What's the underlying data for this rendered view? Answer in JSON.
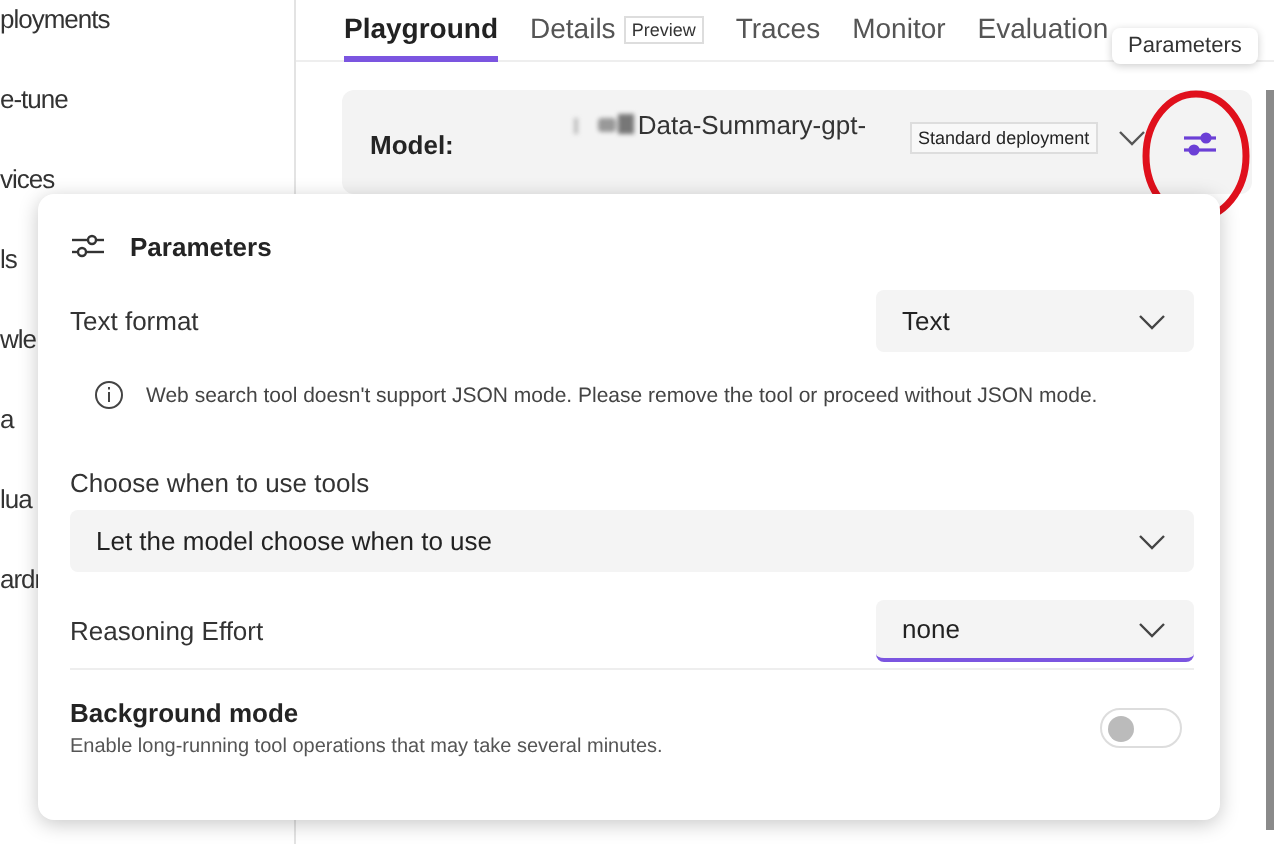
{
  "sidebar": {
    "items": [
      "ployments",
      "e-tune",
      "vices",
      "ls",
      "wle",
      "a",
      "lua",
      "ardr"
    ]
  },
  "tabs": [
    {
      "label": "Playground",
      "selected": true
    },
    {
      "label": "Details",
      "selected": false,
      "badge": "Preview"
    },
    {
      "label": "Traces",
      "selected": false
    },
    {
      "label": "Monitor",
      "selected": false
    },
    {
      "label": "Evaluation",
      "selected": false
    }
  ],
  "model": {
    "label": "Model:",
    "name": "Data-Summary-gpt-",
    "deployment_badge": "Standard deployment"
  },
  "tooltip": "Parameters",
  "parameters_panel": {
    "title": "Parameters",
    "text_format": {
      "label": "Text format",
      "value": "Text"
    },
    "notice": "Web search tool doesn't support JSON mode. Please remove the tool or proceed without JSON mode.",
    "tool_choice": {
      "label": "Choose when to use tools",
      "value": "Let the model choose when to use"
    },
    "reasoning_effort": {
      "label": "Reasoning Effort",
      "value": "none",
      "focused": true
    },
    "background_mode": {
      "title": "Background mode",
      "description": "Enable long-running tool operations that may take several minutes.",
      "on": false
    }
  }
}
